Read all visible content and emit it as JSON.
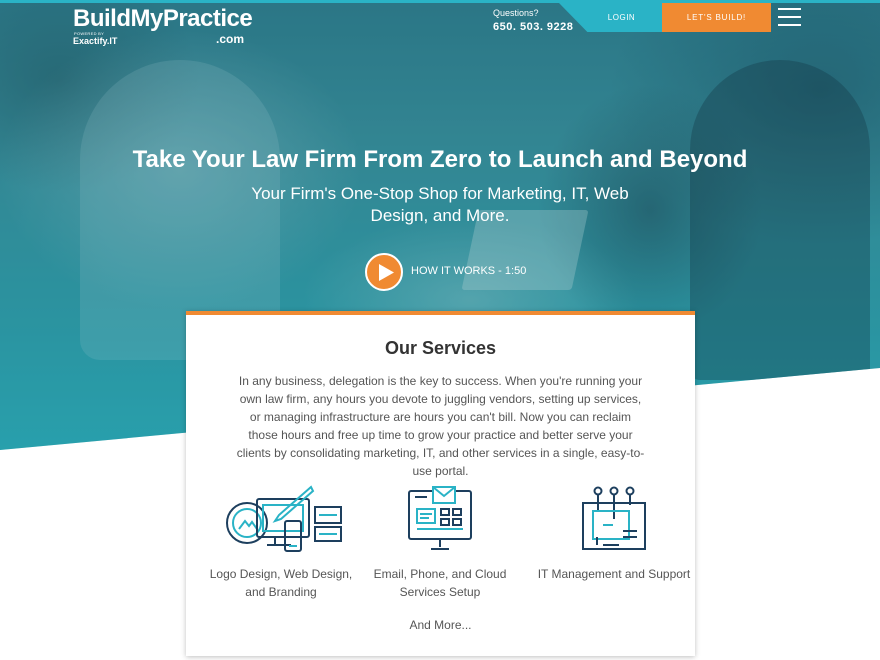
{
  "header": {
    "logo": {
      "main": "BuildMyPractice",
      "powered_by": "POWERED BY",
      "brand": "Exactify.IT",
      "com": ".com"
    },
    "questions_label": "Questions?",
    "phone": "650. 503. 9228",
    "login_label": "LOGIN",
    "build_label": "LET'S BUILD!",
    "menu_icon": "hamburger-menu-icon"
  },
  "hero": {
    "title": "Take Your Law Firm From Zero to Launch and Beyond",
    "subtitle": "Your Firm's One-Stop Shop for Marketing, IT, Web Design, and More.",
    "video_label": "HOW IT WORKS - 1:50",
    "play_icon": "play-icon"
  },
  "services": {
    "title": "Our Services",
    "body": "In any business, delegation is the key to success. When you're running your own law firm, any hours you devote to juggling vendors, setting up services, or managing infrastructure are hours you can't bill. Now you can reclaim those hours and free up time to grow your practice and better serve your clients by consolidating marketing, IT, and other services in a single, easy-to-use portal.",
    "items": [
      {
        "label": "Logo Design, Web Design, and Branding",
        "icon": "design-devices-icon"
      },
      {
        "label": "Email, Phone, and Cloud Services Setup",
        "icon": "monitor-email-icon"
      },
      {
        "label": "IT Management and Support",
        "icon": "circuit-board-icon"
      }
    ],
    "more": "And More..."
  },
  "colors": {
    "accent_orange": "#f08a32",
    "accent_teal": "#2ab3c6",
    "icon_navy": "#1d3f5e"
  }
}
